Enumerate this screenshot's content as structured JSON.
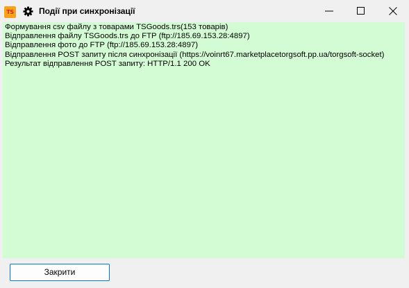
{
  "window": {
    "title": "Події при синхронізації",
    "app_icon_text": "TS",
    "app_icon_color": "#f7a21c",
    "log_background": "#d4fcd4"
  },
  "log": {
    "lines": [
      "Формування csv файлу з товарами TSGoods.trs(153 товарів)",
      "Відправлення файлу TSGoods.trs до FTP (ftp://185.69.153.28:4897)",
      "Відправлення фото до FTP (ftp://185.69.153.28:4897)",
      "Відправлення POST запиту після синхронізації (https://voinrt67.marketplacetorgsoft.pp.ua/torgsoft-socket)",
      "Результат відправлення POST запиту: HTTP/1.1 200 OK"
    ]
  },
  "footer": {
    "close_label": "Закрити",
    "accent_color": "#0078d7"
  }
}
